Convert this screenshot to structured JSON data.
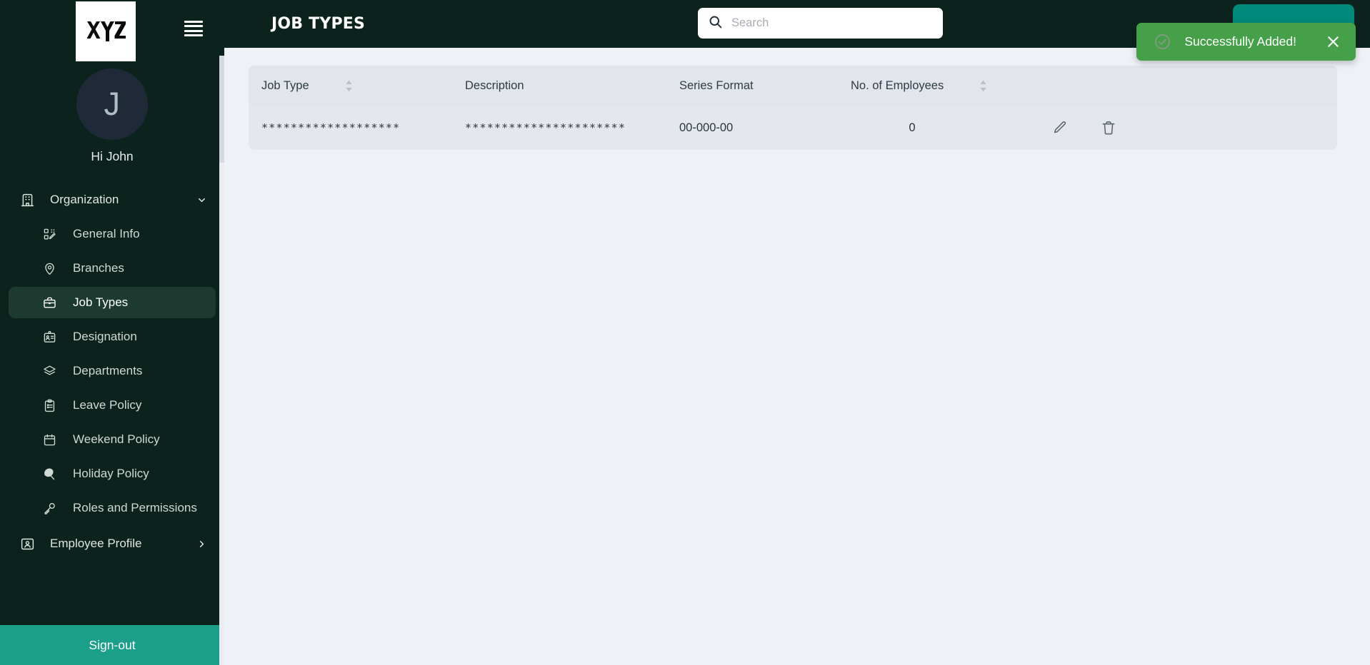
{
  "brand": {
    "logo_text": "XYZ",
    "menu_icon": "hamburger-menu-icon"
  },
  "user": {
    "avatar_initial": "J",
    "greeting": "Hi John"
  },
  "sidebar": {
    "group": {
      "label": "Organization",
      "icon": "building-icon",
      "chevron": "chevron-down-icon",
      "expanded": true
    },
    "items": [
      {
        "label": "General Info",
        "icon": "grid-edit-icon",
        "active": false
      },
      {
        "label": "Branches",
        "icon": "map-pin-icon",
        "active": false
      },
      {
        "label": "Job Types",
        "icon": "briefcase-icon",
        "active": true
      },
      {
        "label": "Designation",
        "icon": "id-badge-icon",
        "active": false
      },
      {
        "label": "Departments",
        "icon": "layers-icon",
        "active": false
      },
      {
        "label": "Leave Policy",
        "icon": "clipboard-list-icon",
        "active": false
      },
      {
        "label": "Weekend Policy",
        "icon": "calendar-icon",
        "active": false
      },
      {
        "label": "Holiday Policy",
        "icon": "beach-umbrella-icon",
        "active": false
      },
      {
        "label": "Roles and Permissions",
        "icon": "key-icon",
        "active": false
      }
    ],
    "secondary_group": {
      "label": "Employee Profile",
      "icon": "user-card-icon",
      "chevron": "chevron-right-icon"
    },
    "sign_out_label": "Sign-out"
  },
  "header": {
    "title": "JOB TYPES",
    "search": {
      "placeholder": "Search",
      "value": "",
      "icon": "search-icon"
    },
    "add_button_label": ""
  },
  "toast": {
    "message": "Successfully Added!",
    "icon": "check-circle-icon",
    "close_icon": "close-icon",
    "background": "#46a049"
  },
  "table": {
    "columns": [
      {
        "label": "Job Type",
        "sortable": true
      },
      {
        "label": "Description",
        "sortable": false
      },
      {
        "label": "Series Format",
        "sortable": false
      },
      {
        "label": "No. of Employees",
        "sortable": true
      },
      {
        "label": "",
        "sortable": false
      }
    ],
    "rows": [
      {
        "job_type": "*******************",
        "description": "**********************",
        "series_format": "00-000-00",
        "employees": "0",
        "edit_icon": "pencil-icon",
        "delete_icon": "trash-icon"
      }
    ]
  },
  "colors": {
    "sidebar_bg": "#0c231d",
    "accent_teal": "#1b9e8a",
    "add_button": "#008a7c",
    "toast_green": "#46a049",
    "content_bg": "#eef1f6",
    "table_header": "#e2e6ec",
    "table_row": "#e4e8ed",
    "active_item": "#1d3a31"
  }
}
